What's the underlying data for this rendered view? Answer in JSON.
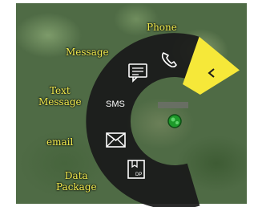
{
  "radial_menu": {
    "labels": {
      "phone": "Phone",
      "message": "Message",
      "text_message": "Text\nMessage",
      "email": "email",
      "data_package": "Data\nPackage"
    },
    "icons": {
      "phone": "phone-icon",
      "message": "chat-bubble-icon",
      "sms": "SMS",
      "email": "envelope-icon",
      "data_package": "package-icon",
      "back": "chevron-left-icon",
      "location": "green-location-marker-icon"
    },
    "colors": {
      "label": "#f3ec4f",
      "ring": "#1a1a1a",
      "active_segment": "#f6e839",
      "location_marker": "#1e9a2a"
    }
  }
}
